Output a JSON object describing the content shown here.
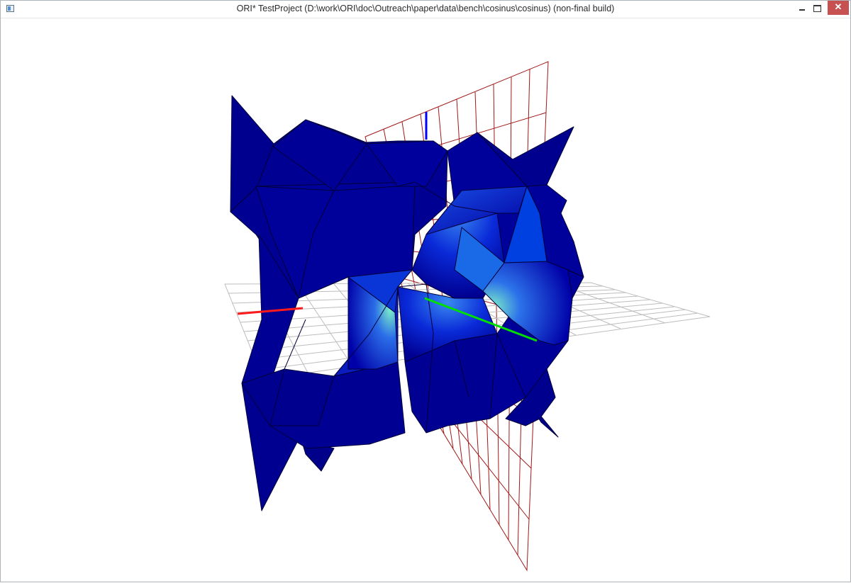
{
  "window": {
    "title": "ORI* TestProject (D:\\work\\ORI\\doc\\Outreach\\paper\\data\\bench\\cosinus\\cosinus) (non-final build)",
    "app_icon": "app-window-icon",
    "controls": {
      "minimize_icon": "minimize-icon",
      "maximize_icon": "maximize-icon",
      "close_icon": "close-icon",
      "close_glyph": "✕"
    }
  },
  "scene": {
    "mesh_color": "#000090",
    "highlight_color": "#7ef0c8",
    "horizontal_grid_color": "#b8b8b8",
    "vertical_grid_color": "#a01818",
    "x_axis_color": "#ff1a1a",
    "y_axis_color": "#00e000",
    "z_axis_color": "#0000ff"
  }
}
